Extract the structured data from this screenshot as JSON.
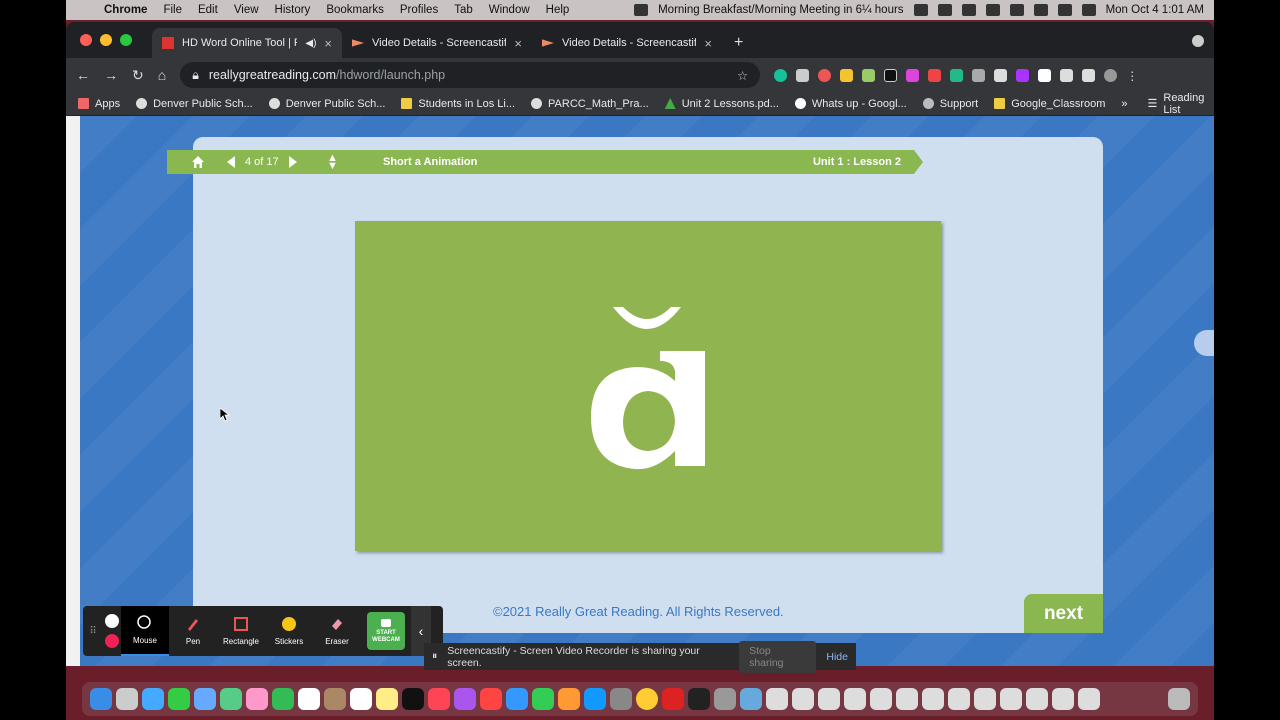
{
  "menubar": {
    "items": [
      "Chrome",
      "File",
      "Edit",
      "View",
      "History",
      "Bookmarks",
      "Profiles",
      "Tab",
      "Window",
      "Help"
    ],
    "meeting": "Morning Breakfast/Morning Meeting in 6¼ hours",
    "datetime": "Mon Oct 4  1:01 AM"
  },
  "tabs": [
    {
      "title": "HD Word Online Tool | Rea",
      "close": "×"
    },
    {
      "title": "Video Details - Screencastify",
      "close": "×"
    },
    {
      "title": "Video Details - Screencastify",
      "close": "×"
    }
  ],
  "newtab": "+",
  "omnibox": {
    "host": "reallygreatreading.com",
    "path": "/hdword/launch.php",
    "star": "☆"
  },
  "bookmarks": [
    "Apps",
    "Denver Public Sch...",
    "Denver Public Sch...",
    "Students in Los Li...",
    "PARCC_Math_Pra...",
    "Unit 2 Lessons.pd...",
    "Whats up - Googl...",
    "Support",
    "Google_Classroom"
  ],
  "bookmarks_more": "»",
  "reading_list": "Reading List",
  "lesson": {
    "count": "4 of 17",
    "title": "Short a Animation",
    "unit": "Unit 1 : Lesson 2",
    "letter": "ă",
    "copyright": "©2021 Really Great Reading. All Rights Reserved.",
    "next": "next"
  },
  "screencastify": {
    "tools": [
      {
        "label": "Mouse"
      },
      {
        "label": "Pen"
      },
      {
        "label": "Rectangle"
      },
      {
        "label": "Stickers"
      },
      {
        "label": "Eraser"
      }
    ],
    "webcam_1": "START",
    "webcam_2": "WEBCAM",
    "collapse": "‹",
    "banner_text": "Screencastify - Screen Video Recorder is sharing your screen.",
    "stop_sharing": "Stop sharing",
    "hide": "Hide"
  },
  "colors": {
    "accent_green": "#8ab750",
    "page_blue": "#3b78c4",
    "card_blue": "#cfdff0"
  }
}
